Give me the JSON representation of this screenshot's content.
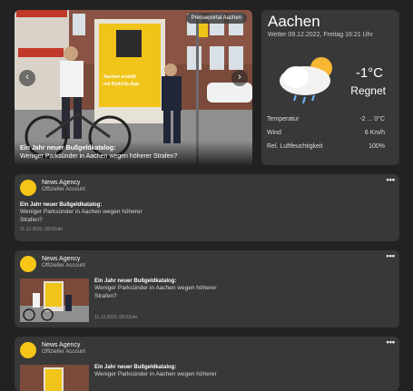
{
  "hero": {
    "badge": "Presseportal Aachen",
    "prev_icon": "chevron-left-icon",
    "next_icon": "chevron-right-icon",
    "poster_line1": "Aachen erstellt",
    "poster_line2": "mit RydeUp-App",
    "caption_title": "Ein Jahr neuer Bußgeldkatalog:",
    "caption_text": "Weniger Parksünder in Aachen wegen höherer Strafen?"
  },
  "weather": {
    "city": "Aachen",
    "subtitle": "Wetter  09.12.2022, Freitag 16:21 Uhr",
    "temperature": "-1°C",
    "condition": "Regnet",
    "icon": "sun-cloud-rain-icon",
    "rows": [
      {
        "label": "Temperatur",
        "value": "-2 ... 0°C"
      },
      {
        "label": "Wind",
        "value": "6 Km/h"
      },
      {
        "label": "Rel. Luftfeuchtigkeit",
        "value": "100%"
      }
    ]
  },
  "news": [
    {
      "agency": "News Agency",
      "account": "Offizieller Account",
      "title": "Ein Jahr neuer Bußgeldkatalog:",
      "text": "Weniger Parksünder in Aachen wegen höherer Strafen?",
      "date": "11.12.2022, 08:02uhr"
    },
    {
      "agency": "News Agency",
      "account": "Offizieller Account",
      "title": "Ein Jahr neuer Bußgeldkatalog:",
      "text": "Weniger Parksünder in Aachen wegen höherer Strafen?",
      "date": "11.12.2022, 08:02uhr"
    },
    {
      "agency": "News Agency",
      "account": "Offizieller Account",
      "title": "Ein Jahr neuer Bußgeldkatalog:",
      "text": "Weniger Parksünder in Aachen wegen höherer"
    }
  ],
  "more_icon": "more-dots-icon",
  "accent_color": "#f5c518"
}
